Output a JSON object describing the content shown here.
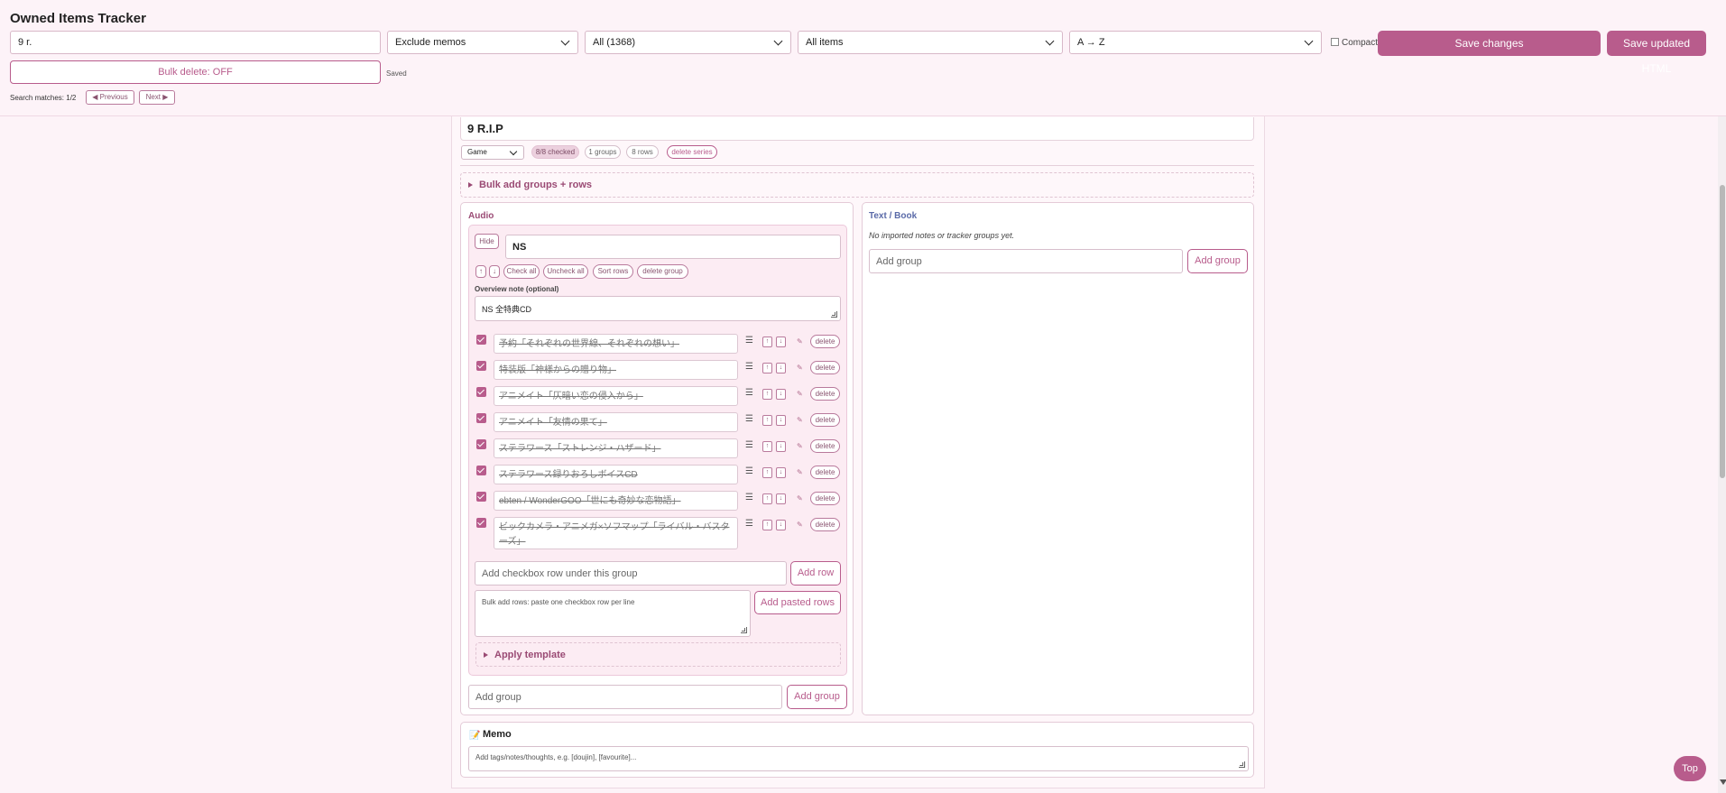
{
  "app": {
    "title": "Owned Items Tracker"
  },
  "toolbar": {
    "search_value": "9 r.",
    "memo_filter": "Exclude memos",
    "count_filter": "All (1368)",
    "item_filter": "All items",
    "sort": "A → Z",
    "compact_label": "Compact",
    "compact_checked": false,
    "save_changes": "Save changes",
    "save_html": "Save updated HTML",
    "bulk_delete": "Bulk delete: OFF",
    "saved_status": "Saved",
    "search_matches": "Search matches: 1/2",
    "prev_label": "◀ Previous",
    "next_label": "Next ▶"
  },
  "series": {
    "title": "9 R.I.P",
    "type": "Game",
    "checked_pill": "8/8 checked",
    "groups_pill": "1 groups",
    "rows_pill": "8 rows",
    "delete_label": "delete series",
    "bulk_add_label": "Bulk add groups + rows"
  },
  "audio": {
    "heading": "Audio",
    "group": {
      "hide_label": "Hide",
      "name": "NS",
      "up_label": "↑",
      "down_label": "↓",
      "check_all": "Check all",
      "uncheck_all": "Uncheck all",
      "sort_rows": "Sort rows",
      "delete_group": "delete group",
      "overview_label": "Overview note (optional)",
      "overview_value": "NS 全特典CD",
      "rows": [
        {
          "text": "予約「それぞれの世界線、それぞれの想い」",
          "checked": true
        },
        {
          "text": "特装版「神様からの贈り物」",
          "checked": true
        },
        {
          "text": "アニメイト「仄暗い恋の侵入から」",
          "checked": true
        },
        {
          "text": "アニメイト「友情の果て」",
          "checked": true
        },
        {
          "text": "ステラワース「ストレンジ・ハザード」",
          "checked": true
        },
        {
          "text": "ステラワース録りおろしボイスCD",
          "checked": true
        },
        {
          "text": "ebten / WonderGOO「世にも奇妙な恋物語」",
          "checked": true
        },
        {
          "text": "ビックカメラ・アニメガ×ソフマップ「ライバル・バスターズ」",
          "checked": true
        }
      ],
      "row_controls": {
        "drag": "☰",
        "up": "↑",
        "down": "↓",
        "memo_icon": "memo-icon",
        "delete": "delete"
      },
      "add_row_placeholder": "Add checkbox row under this group",
      "add_row_button": "Add row",
      "bulk_rows_placeholder": "Bulk add rows: paste one checkbox row per line",
      "add_pasted_button": "Add pasted rows",
      "apply_template": "Apply template"
    },
    "add_group_placeholder": "Add group",
    "add_group_button": "Add group"
  },
  "text_book": {
    "heading": "Text / Book",
    "empty_note": "No imported notes or tracker groups yet.",
    "add_group_placeholder": "Add group",
    "add_group_button": "Add group"
  },
  "memo": {
    "heading": "Memo",
    "placeholder": "Add tags/notes/thoughts, e.g. [doujin], [favourite]..."
  },
  "top_button": "Top",
  "colors": {
    "accent": "#b85c8c",
    "page_bg": "#fdf3f8",
    "audio_heading": "#9a4a74",
    "textbook_heading": "#5a6aa8"
  }
}
